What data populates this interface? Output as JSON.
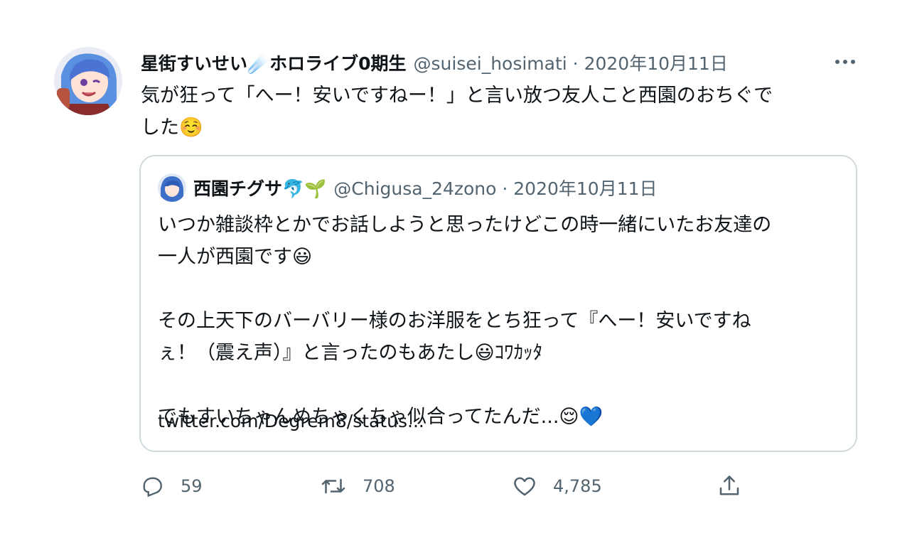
{
  "tweet": {
    "author_name": "星街すいせい☄️ホロライブ0期生",
    "meta": "@suisei_hosimati · 2020年10月11日",
    "text": "気が狂って「へー！安いですねー！」と言い放つ友人こと西園のおちぐで\nした☺️"
  },
  "quoted": {
    "author_name": "西園チグサ🐬🌱",
    "meta": "@Chigusa_24zono · 2020年10月11日",
    "text": "いつか雑談枠とかでお話しようと思ったけどこの時一緒にいたお友達の\n一人が西園です😃\n\nその上天下のバーバリー様のお洋服をとち狂って『へー！安いですね\nぇ！（震え声）』と言ったのもあたし😃ｺﾜｶｯﾀ\n\nでもすいちゃんめちゃくちゃ似合ってたんだ...😌💙",
    "link": "twitter.com/Degrem8/status..."
  },
  "actions": {
    "reply_count": "59",
    "retweet_count": "708",
    "like_count": "4,785"
  },
  "icons": {
    "more": "more-dots-icon",
    "reply": "reply-icon",
    "retweet": "retweet-icon",
    "like": "heart-icon",
    "share": "share-icon"
  },
  "colors": {
    "text_primary": "#0f1419",
    "text_secondary": "#536471",
    "border": "#cfd9de"
  }
}
